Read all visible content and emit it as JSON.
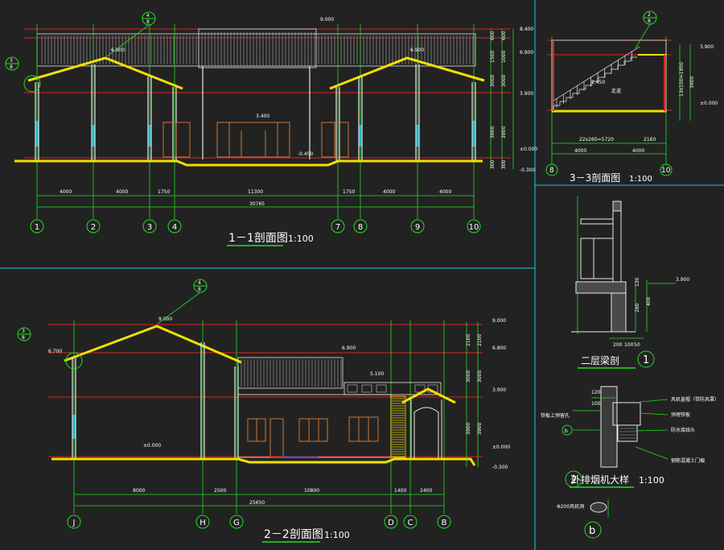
{
  "colors": {
    "background": "#222222",
    "grid_green": "#22dd22",
    "level_red": "#e02020",
    "roof_yellow": "#f0e000",
    "window_cyan": "#18b8c8",
    "frame_brown": "#c87838",
    "divider_cyan": "#18c8d8"
  },
  "section_1_1": {
    "title": "1－1剖面图",
    "scale": "1:100",
    "grid_axes": [
      "1",
      "2",
      "3",
      "4",
      "7",
      "8",
      "9",
      "10"
    ],
    "spans": [
      "4000",
      "4000",
      "1750",
      "11300",
      "1750",
      "4000",
      "4000"
    ],
    "total": "30765",
    "levels": [
      "8.400",
      "6.900",
      "3.900",
      "±0.000",
      "-0.300"
    ],
    "left_dims": [
      "600",
      "1500",
      "3000",
      "3900",
      "300"
    ],
    "right_dims": [
      "600",
      "1000",
      "3000",
      "3900",
      "300"
    ],
    "elev_mid": "6.900",
    "elev_top": "9.000",
    "inner_elev": "3.400",
    "floor_elev": "-0.450",
    "detail_callout": "4",
    "detail_callout_sheet": "8",
    "detail_callout_left": "3",
    "detail_callout_left_sheet": "8"
  },
  "section_2_2": {
    "title": "2－2剖面图",
    "scale": "1:100",
    "grid_axes": [
      "J",
      "H",
      "G",
      "D",
      "C",
      "B"
    ],
    "spans": [
      "8000",
      "2500",
      "10800",
      "1400",
      "2400"
    ],
    "total": "25650",
    "levels": [
      "9.000",
      "6.800",
      "3.900",
      "±0.000",
      "-0.300"
    ],
    "left_dims": [
      "2100",
      "3000",
      "3900"
    ],
    "right_dims": [
      "2100",
      "3000",
      "3900"
    ],
    "ridge_elev": "9.000",
    "eave_elev": "6.700",
    "mid_elev": "6.900",
    "low_elev": "5.100",
    "floor_elev": "±0.000",
    "detail_callout": "4",
    "detail_callout_sheet": "8",
    "detail_callout_left": "3",
    "detail_callout_left_sheet": "8"
  },
  "section_3_3": {
    "title": "3－3剖面图",
    "scale": "1:100",
    "grid_axes": [
      "8",
      "10"
    ],
    "spans": [
      "4000",
      "4000"
    ],
    "stair_dim": "22x260=5720",
    "stair_dim_right": "2160",
    "elev_top": "3.900",
    "elev_floor": "±0.000",
    "room_label": "走道",
    "stair_elev": "2.450",
    "stair_vert_dim": "13x150=1950",
    "right_dim": "3900",
    "detail_callout": "2",
    "detail_callout_sheet": "8"
  },
  "detail_1": {
    "title": "二层梁剖",
    "number": "1",
    "elev": "3.900",
    "dims": [
      "120",
      "280",
      "400",
      "250",
      "200",
      "100",
      "50"
    ]
  },
  "detail_2": {
    "title": "外排烟机大样",
    "number": "2",
    "scale": "1:100",
    "labels": [
      "风机盖帽（带防风罩）",
      "预埋铁板",
      "防水接线头",
      "铁板上预留孔",
      "钢筋混凝土门楣"
    ],
    "dims": [
      "120",
      "100"
    ],
    "callout": "b"
  },
  "detail_b": {
    "callout": "b",
    "label": "Φ200风机洞"
  }
}
